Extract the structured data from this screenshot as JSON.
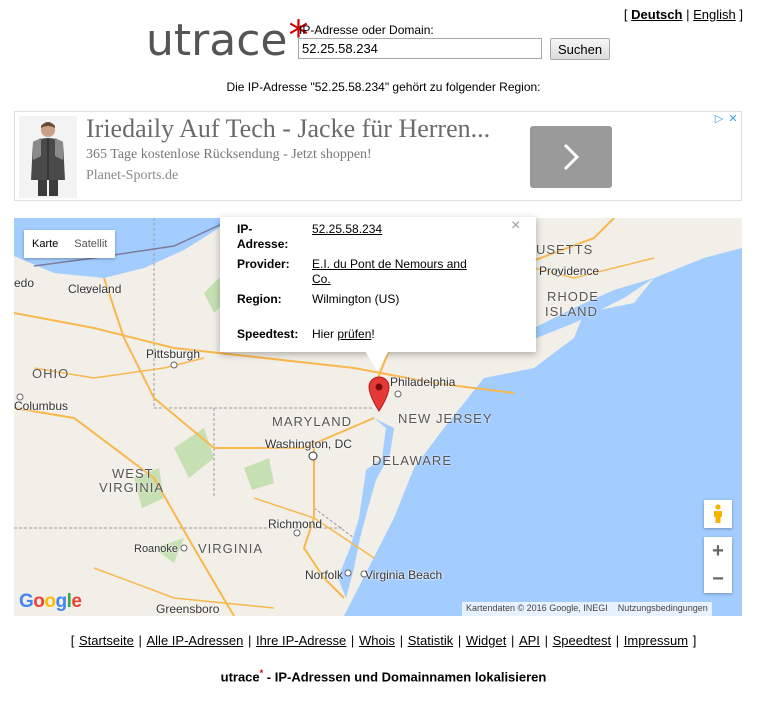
{
  "lang": {
    "open": "[",
    "active": "Deutsch",
    "sep": "|",
    "other": "English",
    "close": "]"
  },
  "logo": {
    "text": "utrace",
    "star": "*"
  },
  "search": {
    "label": "IP-Adresse oder Domain:",
    "value": "52.25.58.234",
    "button": "Suchen"
  },
  "region_line": "Die IP-Adresse \"52.25.58.234\" gehört zu folgender Region:",
  "ad": {
    "title": "Iriedaily Auf Tech - Jacke für Herren...",
    "subtitle": "365 Tage kostenlose Rücksendung - Jetzt shoppen!",
    "site": "Planet-Sports.de",
    "arrow_icon": "chevron-right-icon",
    "choice_icons": [
      "adchoices-icon",
      "close-icon"
    ]
  },
  "map": {
    "maptype": {
      "map": "Karte",
      "satellite": "Satellit"
    },
    "labels": {
      "cleveland": "Cleveland",
      "pittsburgh": "Pittsburgh",
      "ohio": "OHIO",
      "columbus": "Columbus",
      "philadelphia": "Philadelphia",
      "new_jersey": "NEW JERSEY",
      "maryland": "MARYLAND",
      "delaware": "DELAWARE",
      "washington": "Washington, DC",
      "west": "WEST",
      "virginia_w": "VIRGINIA",
      "virginia": "VIRGINIA",
      "richmond": "Richmond",
      "roanoke": "Roanoke",
      "norfolk": "Norfolk",
      "virginia_beach": "Virginia Beach",
      "greensboro": "Greensboro",
      "providence": "Providence",
      "rhode": "RHODE",
      "island": "ISLAND",
      "usetts": "USETTS",
      "edo": "edo"
    },
    "popup": {
      "ip_key": "IP-",
      "ip_key2": "Adresse:",
      "ip_value": "52.25.58.234",
      "provider_key": "Provider:",
      "provider_value1": "E.I. du Pont de Nemours and",
      "provider_value2": "Co.",
      "region_key": "Region:",
      "region_value": "Wilmington (US)",
      "speed_key": "Speedtest:",
      "speed_prefix": "Hier ",
      "speed_link": "prüfen",
      "speed_suffix": "!",
      "close": "×"
    },
    "zoom_in": "+",
    "zoom_out": "−",
    "google": [
      "G",
      "o",
      "o",
      "g",
      "l",
      "e"
    ],
    "attribution": "Kartendaten © 2016 Google, INEGI",
    "terms": "Nutzungsbedingungen",
    "colors": {
      "water": "#a3ccff",
      "land": "#f1efe7",
      "road": "#f9b74c",
      "park": "#c6e0b4",
      "marker": "#e53935"
    }
  },
  "footer": {
    "open": "[",
    "links": [
      "Startseite",
      "Alle IP-Adressen",
      "Ihre IP-Adresse",
      "Whois",
      "Statistik",
      "Widget",
      "API",
      "Speedtest",
      "Impressum"
    ],
    "sep": "|",
    "close": "]",
    "tagline_brand": "utrace",
    "tagline_star": "*",
    "tagline_rest": " - IP-Adressen und Domainnamen lokalisieren"
  }
}
